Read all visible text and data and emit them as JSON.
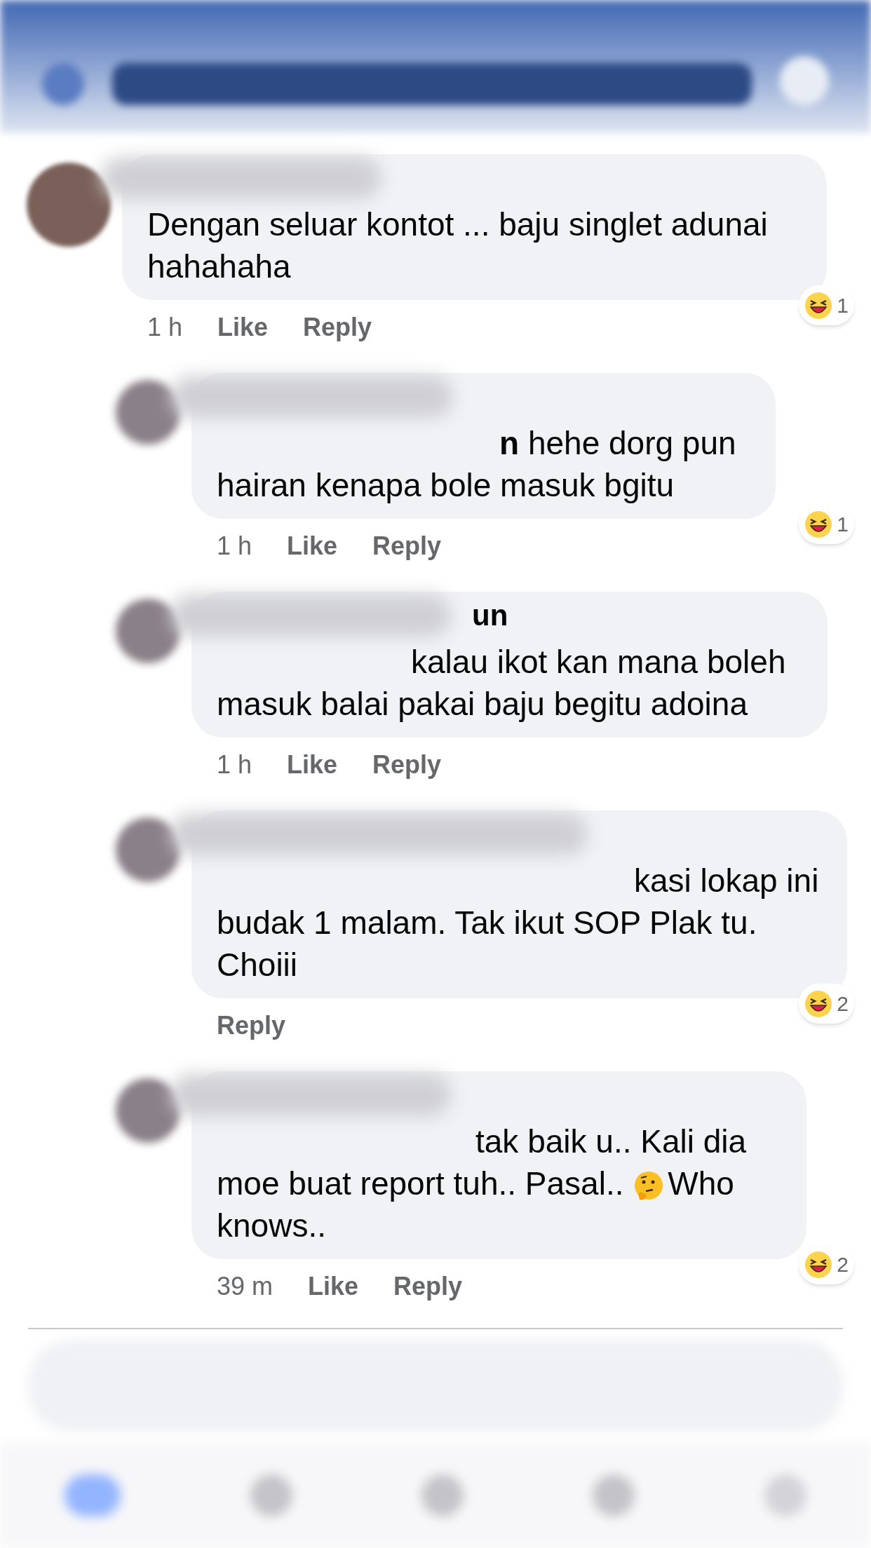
{
  "comments": [
    {
      "segments": [
        {
          "kind": "text",
          "text": "Dengan seluar kontot ... baju singlet adunai hahahaha"
        }
      ],
      "meta": [
        "1 h",
        "Like",
        "Reply"
      ],
      "reaction": {
        "count": "1"
      },
      "children": [
        {
          "segments": [
            {
              "kind": "text",
              "text": "**n** hehe dorg pun hairan kenapa bole masuk bgitu"
            }
          ],
          "meta": [
            "1 h",
            "Like",
            "Reply"
          ],
          "reaction": {
            "count": "1"
          }
        },
        {
          "name_fragment": "un",
          "segments": [
            {
              "kind": "text",
              "text": "kalau ikot kan mana boleh masuk balai pakai baju begitu adoina"
            }
          ],
          "meta": [
            "1 h",
            "Like",
            "Reply"
          ]
        },
        {
          "segments": [
            {
              "kind": "text",
              "text": "kasi lokap ini budak 1 malam. Tak ikut SOP Plak tu. Choiii"
            }
          ],
          "meta": [
            "Reply"
          ],
          "reaction": {
            "count": "2"
          }
        },
        {
          "segments": [
            {
              "kind": "text",
              "text": "tak baik u..  Kali dia moe buat report tuh.. Pasal..  "
            },
            {
              "kind": "thinking"
            },
            {
              "kind": "text",
              "text": "Who knows.."
            }
          ],
          "meta": [
            "39 m",
            "Like",
            "Reply"
          ],
          "reaction": {
            "count": "2"
          }
        }
      ]
    }
  ]
}
